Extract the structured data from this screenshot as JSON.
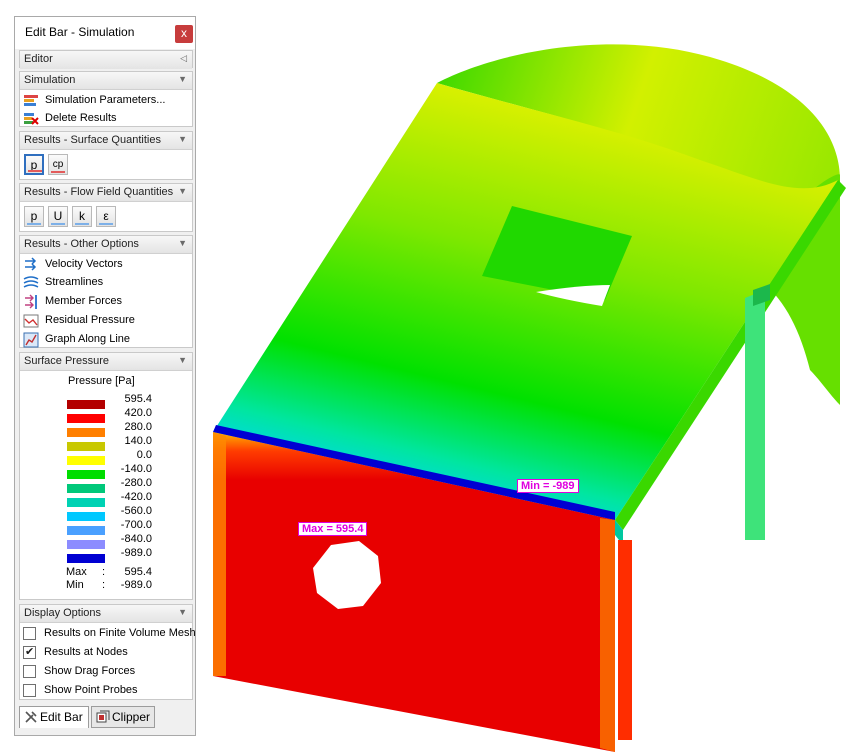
{
  "panel": {
    "title": "Edit Bar - Simulation",
    "close_label": "x",
    "editor": {
      "label": "Editor"
    },
    "simulation": {
      "label": "Simulation",
      "items": [
        "Simulation Parameters...",
        "Delete Results"
      ]
    },
    "surface_quantities": {
      "label": "Results - Surface Quantities",
      "buttons": [
        "p",
        "cp"
      ]
    },
    "flow_field": {
      "label": "Results - Flow Field Quantities",
      "buttons": [
        "p",
        "U",
        "k",
        "ε"
      ]
    },
    "other_options": {
      "label": "Results - Other Options",
      "items": [
        "Velocity Vectors",
        "Streamlines",
        "Member Forces",
        "Residual Pressure",
        "Graph Along Line"
      ]
    },
    "surface_pressure": {
      "label": "Surface Pressure",
      "legend_title": "Pressure [Pa]",
      "levels": [
        "595.4",
        "420.0",
        "280.0",
        "140.0",
        "0.0",
        "-140.0",
        "-280.0",
        "-420.0",
        "-560.0",
        "-700.0",
        "-840.0",
        "-989.0"
      ],
      "colors": [
        "#b30000",
        "#ff0000",
        "#ff7f00",
        "#c8c800",
        "#ffff00",
        "#00dd00",
        "#00c87a",
        "#00d2b4",
        "#00c8ff",
        "#4aa0ff",
        "#8c8cff",
        "#0000d2"
      ],
      "max_label": "Max",
      "max_sep": ":",
      "max_value": "595.4",
      "min_label": "Min",
      "min_sep": ":",
      "min_value": "-989.0"
    },
    "display_options": {
      "label": "Display Options",
      "items": [
        {
          "label": "Results on Finite Volume Mesh",
          "checked": false
        },
        {
          "label": "Results at Nodes",
          "checked": true
        },
        {
          "label": "Show Drag Forces",
          "checked": false
        },
        {
          "label": "Show Point Probes",
          "checked": false
        }
      ]
    },
    "tabs": [
      "Edit Bar",
      "Clipper"
    ]
  },
  "viewport": {
    "max_tag": "Max = 595.4",
    "min_tag": "Min = -989"
  }
}
